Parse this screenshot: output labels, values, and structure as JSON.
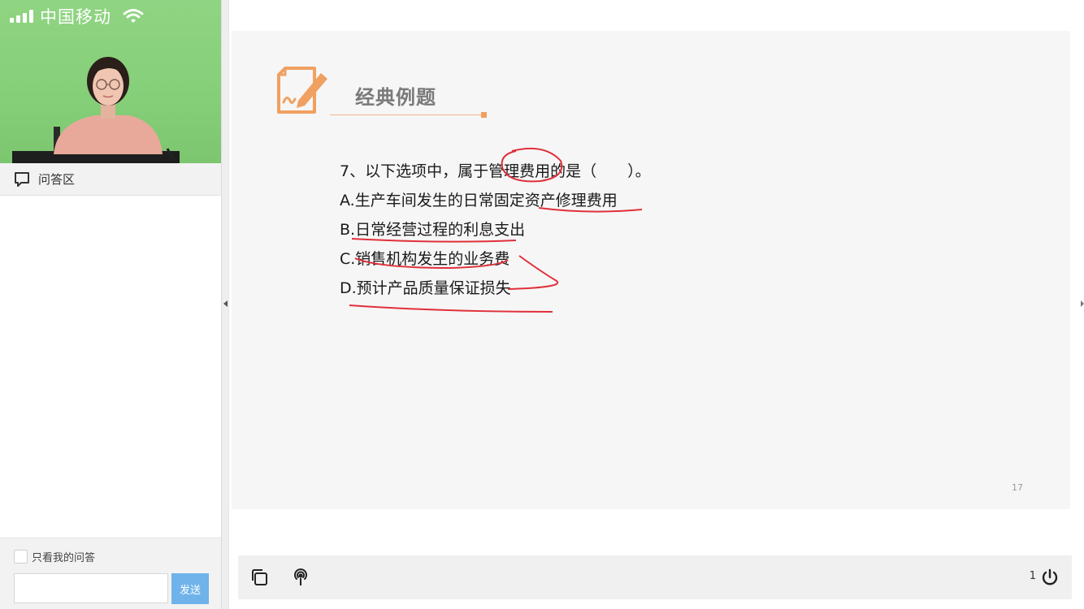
{
  "status_bar": {
    "carrier": "中国移动"
  },
  "qa": {
    "title": "问答区",
    "only_mine_label": "只看我的问答",
    "input_value": "",
    "send_label": "发送"
  },
  "slide": {
    "heading": "经典例题",
    "question": "7、以下选项中，属于管理费用的是（　　）。",
    "options": [
      "A.生产车间发生的日常固定资产修理费用",
      "B.日常经营过程的利息支出",
      "C.销售机构发生的业务费",
      "D.预计产品质量保证损失"
    ],
    "page_number": "17"
  },
  "toolbar": {
    "count": "1"
  },
  "icons": {
    "status": [
      "signal-icon",
      "wifi-icon"
    ],
    "qa": [
      "chat-bubble-icon"
    ],
    "slide": [
      "note-edit-icon"
    ],
    "toolbar": [
      "copy-icon",
      "broadcast-icon",
      "power-icon"
    ]
  },
  "colors": {
    "accent_orange": "#f0a060",
    "send_button": "#6fb3ea",
    "annotation_pen": "#e0303a",
    "video_background": "#86cf79"
  }
}
